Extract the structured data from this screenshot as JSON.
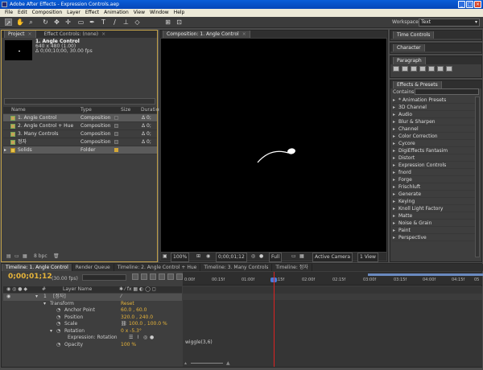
{
  "window": {
    "title": "Adobe After Effects - Expression Controls.aep"
  },
  "menu": [
    "File",
    "Edit",
    "Composition",
    "Layer",
    "Effect",
    "Animation",
    "View",
    "Window",
    "Help"
  ],
  "workspace": {
    "label": "Workspace:",
    "value": "Text"
  },
  "project": {
    "tabs": [
      {
        "label": "Project"
      },
      {
        "label": "Effect Controls: (none)"
      }
    ],
    "selected_name": "1. Angle Control",
    "info_line1": "640 x 480 (1.00)",
    "info_line2": "Δ 0;00;10;00, 30.00 fps",
    "columns": [
      "Name",
      "Type",
      "Size",
      "Duration"
    ],
    "items": [
      {
        "name": "1. Angle Control",
        "type": "Composition",
        "dur": "Δ 0;",
        "kind": "comp"
      },
      {
        "name": "2. Angle Control + Hue",
        "type": "Composition",
        "dur": "Δ 0;",
        "kind": "comp"
      },
      {
        "name": "3. Many Controls",
        "type": "Composition",
        "dur": "Δ 0;",
        "kind": "comp"
      },
      {
        "name": "정자",
        "type": "Composition",
        "dur": "Δ 0;",
        "kind": "comp"
      },
      {
        "name": "Solids",
        "type": "Folder",
        "dur": "",
        "kind": "folder"
      }
    ],
    "footer_bpc": "8 bpc"
  },
  "composition": {
    "tab": "Composition: 1. Angle Control",
    "footer": {
      "zoom": "100%",
      "time": "0;00;01;12",
      "res": "Full",
      "camera": "Active Camera",
      "views": "1 View"
    }
  },
  "right": {
    "time_controls": "Time Controls",
    "character": "Character",
    "paragraph": "Paragraph",
    "effects_tab": "Effects & Presets",
    "contains_label": "Contains:",
    "effects": [
      "* Animation Presets",
      "3D Channel",
      "Audio",
      "Blur & Sharpen",
      "Channel",
      "Color Correction",
      "Cycore",
      "DigiEffects Fantasim",
      "Distort",
      "Expression Controls",
      "fnord",
      "Forge",
      "Frischluft",
      "Generate",
      "Keying",
      "Knoll Light Factory",
      "Matte",
      "Noise & Grain",
      "Paint",
      "Perspective"
    ]
  },
  "timeline": {
    "tabs": [
      "Timeline: 1. Angle Control",
      "Render Queue",
      "Timeline: 2. Angle Control + Hue",
      "Timeline: 3. Many Controls",
      "Timeline: 정자"
    ],
    "timecode": "0;00;01;12",
    "fps": "(30.00 fps)",
    "layer_header": "Layer Name",
    "ruler_ticks": [
      "0:00f",
      "00:15f",
      "01:00f",
      "01:15f",
      "02:00f",
      "02:15f",
      "03:00f",
      "03:15f",
      "04:00f",
      "04:15f",
      "05"
    ],
    "layer": {
      "num": "1",
      "name": "[정자]"
    },
    "props": [
      {
        "label": "Transform",
        "value": "Reset",
        "indent": 1
      },
      {
        "label": "Anchor Point",
        "value": "60.0 , 60.0",
        "indent": 2
      },
      {
        "label": "Position",
        "value": "320.0 , 240.0",
        "indent": 2
      },
      {
        "label": "Scale",
        "value": "100.0 , 100.0 %",
        "indent": 2
      },
      {
        "label": "Rotation",
        "value": "0 x -5.3°",
        "indent": 2
      },
      {
        "label": "Expression: Rotation",
        "value": "",
        "indent": 3
      },
      {
        "label": "Opacity",
        "value": "100 %",
        "indent": 2
      }
    ],
    "expression": "wiggle(3,6)"
  }
}
